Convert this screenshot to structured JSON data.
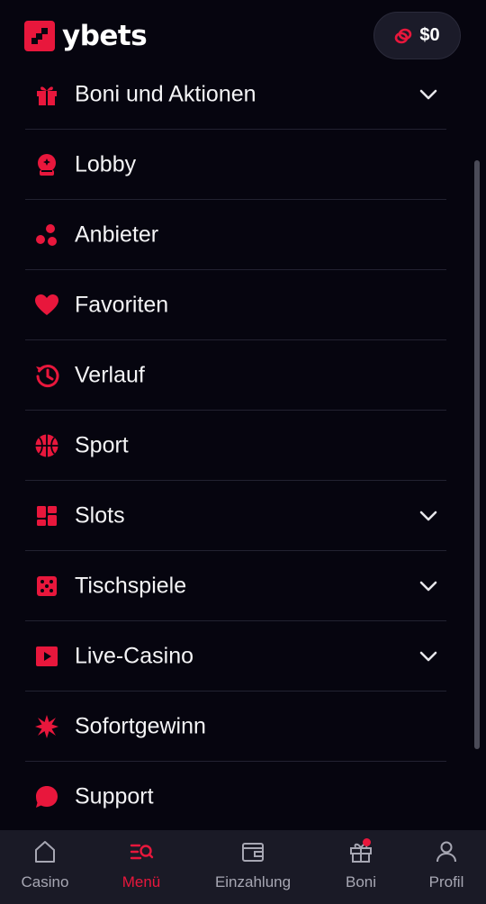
{
  "brand": {
    "name": "ybets",
    "accent": "#e8173c",
    "background": "#06050f"
  },
  "header": {
    "balance": "$0",
    "balance_icon": "coins-icon"
  },
  "menu": {
    "items": [
      {
        "label": "Boni und Aktionen",
        "icon": "gift-icon",
        "expandable": true
      },
      {
        "label": "Lobby",
        "icon": "crystal-ball-icon",
        "expandable": false
      },
      {
        "label": "Anbieter",
        "icon": "providers-icon",
        "expandable": false
      },
      {
        "label": "Favoriten",
        "icon": "heart-icon",
        "expandable": false
      },
      {
        "label": "Verlauf",
        "icon": "history-icon",
        "expandable": false
      },
      {
        "label": "Sport",
        "icon": "basketball-icon",
        "expandable": false
      },
      {
        "label": "Slots",
        "icon": "slots-icon",
        "expandable": true
      },
      {
        "label": "Tischspiele",
        "icon": "dice-icon",
        "expandable": true
      },
      {
        "label": "Live-Casino",
        "icon": "play-icon",
        "expandable": true
      },
      {
        "label": "Sofortgewinn",
        "icon": "burst-icon",
        "expandable": false
      },
      {
        "label": "Support",
        "icon": "chat-icon",
        "expandable": false
      }
    ]
  },
  "bottom_nav": {
    "items": [
      {
        "label": "Casino",
        "icon": "home-icon",
        "active": false
      },
      {
        "label": "Menü",
        "icon": "menu-search-icon",
        "active": true
      },
      {
        "label": "Einzahlung",
        "icon": "wallet-icon",
        "active": false
      },
      {
        "label": "Boni",
        "icon": "gift-icon",
        "active": false,
        "notification": true
      },
      {
        "label": "Profil",
        "icon": "user-icon",
        "active": false
      }
    ]
  }
}
